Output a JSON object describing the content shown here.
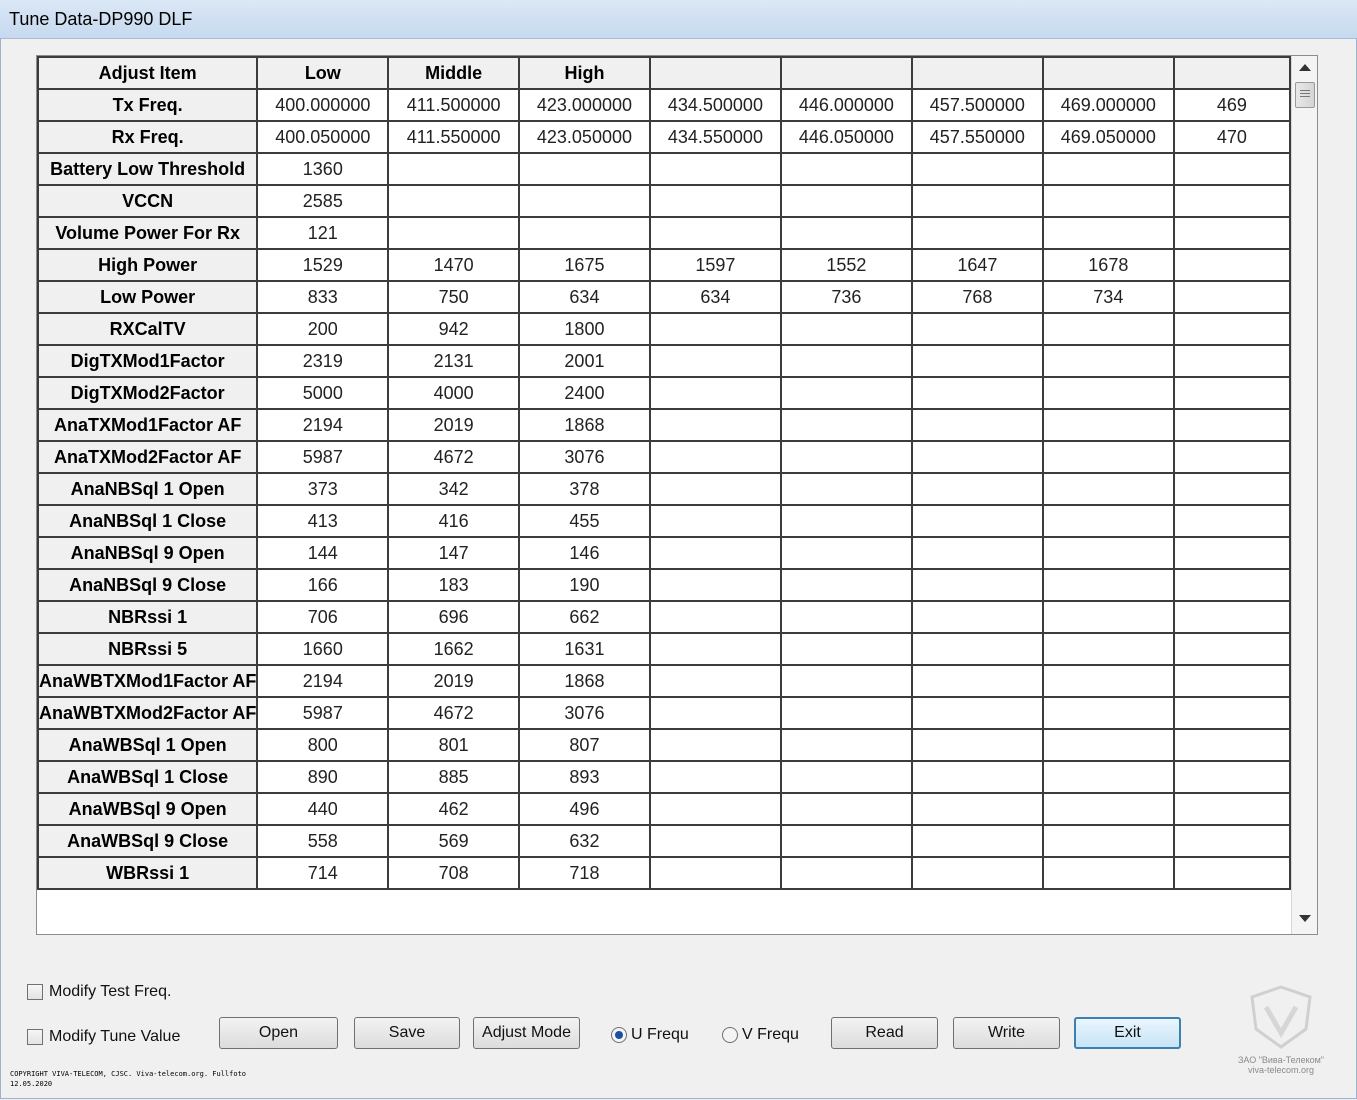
{
  "window": {
    "title": "Tune Data-DP990 DLF"
  },
  "grid": {
    "headers": [
      "Adjust Item",
      "Low",
      "Middle",
      "High",
      "",
      "",
      "",
      "",
      ""
    ],
    "rows": [
      {
        "label": "Tx Freq.",
        "values": [
          "400.000000",
          "411.500000",
          "423.000000",
          "434.500000",
          "446.000000",
          "457.500000",
          "469.000000",
          "469"
        ]
      },
      {
        "label": "Rx Freq.",
        "values": [
          "400.050000",
          "411.550000",
          "423.050000",
          "434.550000",
          "446.050000",
          "457.550000",
          "469.050000",
          "470"
        ]
      },
      {
        "label": "Battery Low Threshold",
        "values": [
          "1360",
          "",
          "",
          "",
          "",
          "",
          "",
          ""
        ]
      },
      {
        "label": "VCCN",
        "values": [
          "2585",
          "",
          "",
          "",
          "",
          "",
          "",
          ""
        ]
      },
      {
        "label": "Volume Power For Rx",
        "values": [
          "121",
          "",
          "",
          "",
          "",
          "",
          "",
          ""
        ]
      },
      {
        "label": "High Power",
        "values": [
          "1529",
          "1470",
          "1675",
          "1597",
          "1552",
          "1647",
          "1678",
          ""
        ]
      },
      {
        "label": "Low Power",
        "values": [
          "833",
          "750",
          "634",
          "634",
          "736",
          "768",
          "734",
          ""
        ]
      },
      {
        "label": "RXCalTV",
        "values": [
          "200",
          "942",
          "1800",
          "",
          "",
          "",
          "",
          ""
        ]
      },
      {
        "label": "DigTXMod1Factor",
        "values": [
          "2319",
          "2131",
          "2001",
          "",
          "",
          "",
          "",
          ""
        ]
      },
      {
        "label": "DigTXMod2Factor",
        "values": [
          "5000",
          "4000",
          "2400",
          "",
          "",
          "",
          "",
          ""
        ]
      },
      {
        "label": "AnaTXMod1Factor AF",
        "values": [
          "2194",
          "2019",
          "1868",
          "",
          "",
          "",
          "",
          ""
        ]
      },
      {
        "label": "AnaTXMod2Factor AF",
        "values": [
          "5987",
          "4672",
          "3076",
          "",
          "",
          "",
          "",
          ""
        ]
      },
      {
        "label": "AnaNBSql 1 Open",
        "values": [
          "373",
          "342",
          "378",
          "",
          "",
          "",
          "",
          ""
        ]
      },
      {
        "label": "AnaNBSql 1 Close",
        "values": [
          "413",
          "416",
          "455",
          "",
          "",
          "",
          "",
          ""
        ]
      },
      {
        "label": "AnaNBSql 9 Open",
        "values": [
          "144",
          "147",
          "146",
          "",
          "",
          "",
          "",
          ""
        ]
      },
      {
        "label": "AnaNBSql 9 Close",
        "values": [
          "166",
          "183",
          "190",
          "",
          "",
          "",
          "",
          ""
        ]
      },
      {
        "label": "NBRssi 1",
        "values": [
          "706",
          "696",
          "662",
          "",
          "",
          "",
          "",
          ""
        ]
      },
      {
        "label": "NBRssi 5",
        "values": [
          "1660",
          "1662",
          "1631",
          "",
          "",
          "",
          "",
          ""
        ]
      },
      {
        "label": "AnaWBTXMod1Factor AF",
        "values": [
          "2194",
          "2019",
          "1868",
          "",
          "",
          "",
          "",
          ""
        ]
      },
      {
        "label": "AnaWBTXMod2Factor AF",
        "values": [
          "5987",
          "4672",
          "3076",
          "",
          "",
          "",
          "",
          ""
        ]
      },
      {
        "label": "AnaWBSql 1 Open",
        "values": [
          "800",
          "801",
          "807",
          "",
          "",
          "",
          "",
          ""
        ]
      },
      {
        "label": "AnaWBSql 1 Close",
        "values": [
          "890",
          "885",
          "893",
          "",
          "",
          "",
          "",
          ""
        ]
      },
      {
        "label": "AnaWBSql 9 Open",
        "values": [
          "440",
          "462",
          "496",
          "",
          "",
          "",
          "",
          ""
        ]
      },
      {
        "label": "AnaWBSql 9 Close",
        "values": [
          "558",
          "569",
          "632",
          "",
          "",
          "",
          "",
          ""
        ]
      },
      {
        "label": "WBRssi 1",
        "values": [
          "714",
          "708",
          "718",
          "",
          "",
          "",
          "",
          ""
        ]
      }
    ]
  },
  "controls": {
    "modify_test_freq": "Modify Test Freq.",
    "modify_tune_value": "Modify Tune Value",
    "open": "Open",
    "save": "Save",
    "adjust_mode": "Adjust Mode",
    "u_freq": "U Frequ",
    "v_freq": "V Frequ",
    "read": "Read",
    "write": "Write",
    "exit": "Exit"
  },
  "footer": {
    "copyright_line1": "COPYRIGHT VIVA-TELECOM, CJSC. Viva-telecom.org. Fullfoto",
    "copyright_line2": "12.05.2020",
    "watermark_line1": "ЗАО \"Вива-Телеком\"",
    "watermark_line2": "viva-telecom.org"
  }
}
